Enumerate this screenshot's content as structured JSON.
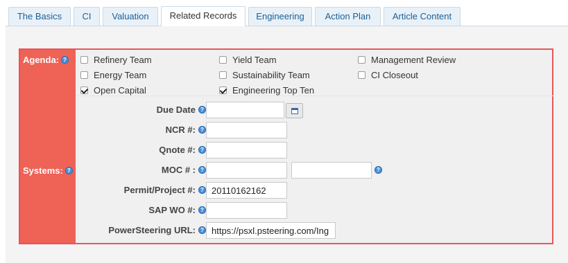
{
  "tabs": [
    {
      "label": "The Basics",
      "active": false
    },
    {
      "label": "CI",
      "active": false
    },
    {
      "label": "Valuation",
      "active": false
    },
    {
      "label": "Related Records",
      "active": true
    },
    {
      "label": "Engineering",
      "active": false
    },
    {
      "label": "Action Plan",
      "active": false
    },
    {
      "label": "Article Content",
      "active": false
    }
  ],
  "agenda": {
    "label": "Agenda:",
    "options": [
      {
        "label": "Refinery Team",
        "checked": false
      },
      {
        "label": "Yield Team",
        "checked": false
      },
      {
        "label": "Management Review",
        "checked": false
      },
      {
        "label": "Energy Team",
        "checked": false
      },
      {
        "label": "Sustainability Team",
        "checked": false
      },
      {
        "label": "CI Closeout",
        "checked": false
      },
      {
        "label": "Open Capital",
        "checked": true
      },
      {
        "label": "Engineering Top Ten",
        "checked": true
      }
    ]
  },
  "systems": {
    "label": "Systems:",
    "fields": {
      "due_date": {
        "label": "Due Date",
        "value": ""
      },
      "ncr": {
        "label": "NCR #:",
        "value": ""
      },
      "qnote": {
        "label": "Qnote #:",
        "value": ""
      },
      "moc": {
        "label": "MOC # :",
        "value": "",
        "value2": ""
      },
      "permit": {
        "label": "Permit/Project #:",
        "value": "20110162162"
      },
      "sap_wo": {
        "label": "SAP WO #:",
        "value": ""
      },
      "powersteering": {
        "label": "PowerSteering URL:",
        "value": "https://psxl.psteering.com/Ing"
      }
    }
  },
  "icons": {
    "help": "help-icon",
    "calendar": "calendar-icon"
  },
  "colors": {
    "accent": "#ef6256",
    "border": "#e8555a",
    "tab_text": "#1b5f95",
    "help": "#4a90d9"
  }
}
